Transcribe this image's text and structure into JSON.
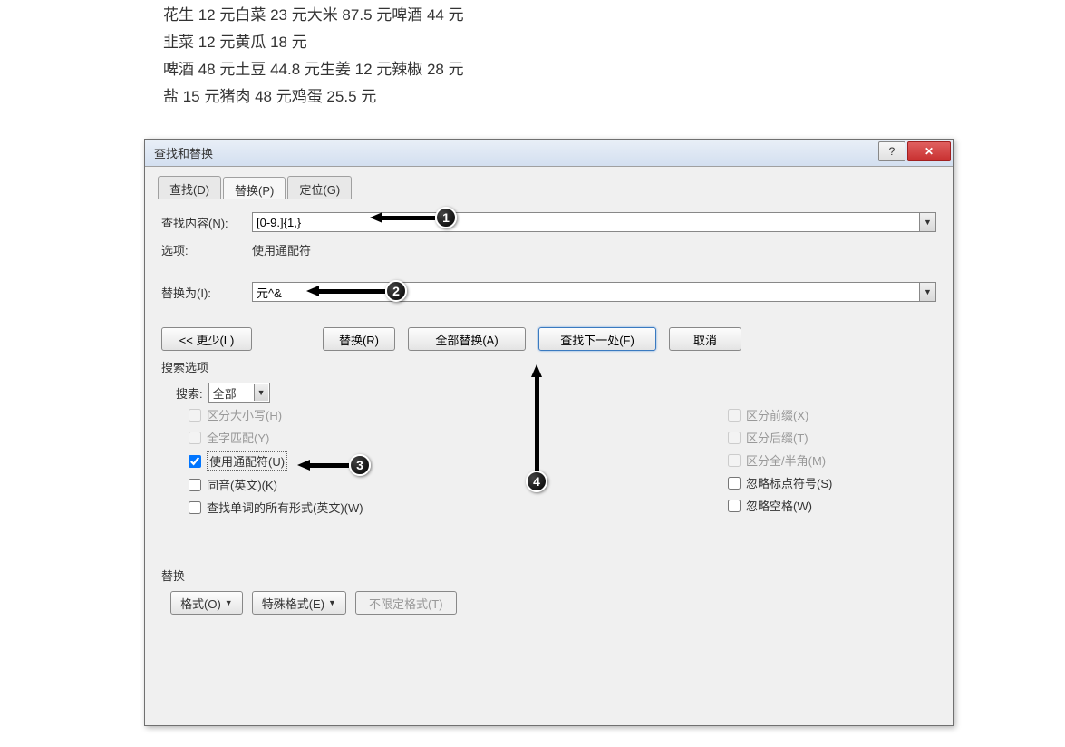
{
  "document": {
    "lines": [
      "花生 12 元白菜 23 元大米 87.5 元啤酒 44 元",
      "韭菜 12 元黄瓜 18 元",
      "啤酒 48 元土豆 44.8 元生姜 12 元辣椒 28 元",
      "盐 15 元猪肉 48 元鸡蛋 25.5 元"
    ]
  },
  "dialog": {
    "title": "查找和替换",
    "help_icon": "?",
    "close_icon": "✕",
    "tabs": {
      "find": "查找(D)",
      "replace": "替换(P)",
      "goto": "定位(G)"
    },
    "find_label": "查找内容(N):",
    "find_value": "[0-9.]{1,}",
    "options_label": "选项:",
    "options_value": "使用通配符",
    "replace_label": "替换为(I):",
    "replace_value": "元^&",
    "buttons": {
      "less": "<< 更少(L)",
      "replace": "替换(R)",
      "replace_all": "全部替换(A)",
      "find_next": "查找下一处(F)",
      "cancel": "取消"
    },
    "search_options_header": "搜索选项",
    "search_label": "搜索:",
    "search_value": "全部",
    "checkboxes_left": {
      "match_case": "区分大小写(H)",
      "whole_word": "全字匹配(Y)",
      "wildcards": "使用通配符(U)",
      "sounds_like": "同音(英文)(K)",
      "word_forms": "查找单词的所有形式(英文)(W)"
    },
    "checkboxes_right": {
      "prefix": "区分前缀(X)",
      "suffix": "区分后缀(T)",
      "full_half": "区分全/半角(M)",
      "punctuation": "忽略标点符号(S)",
      "whitespace": "忽略空格(W)"
    },
    "replace_section_header": "替换",
    "bottom_buttons": {
      "format": "格式(O)",
      "special": "特殊格式(E)",
      "no_format": "不限定格式(T)"
    }
  },
  "callouts": {
    "c1": "1",
    "c2": "2",
    "c3": "3",
    "c4": "4"
  }
}
